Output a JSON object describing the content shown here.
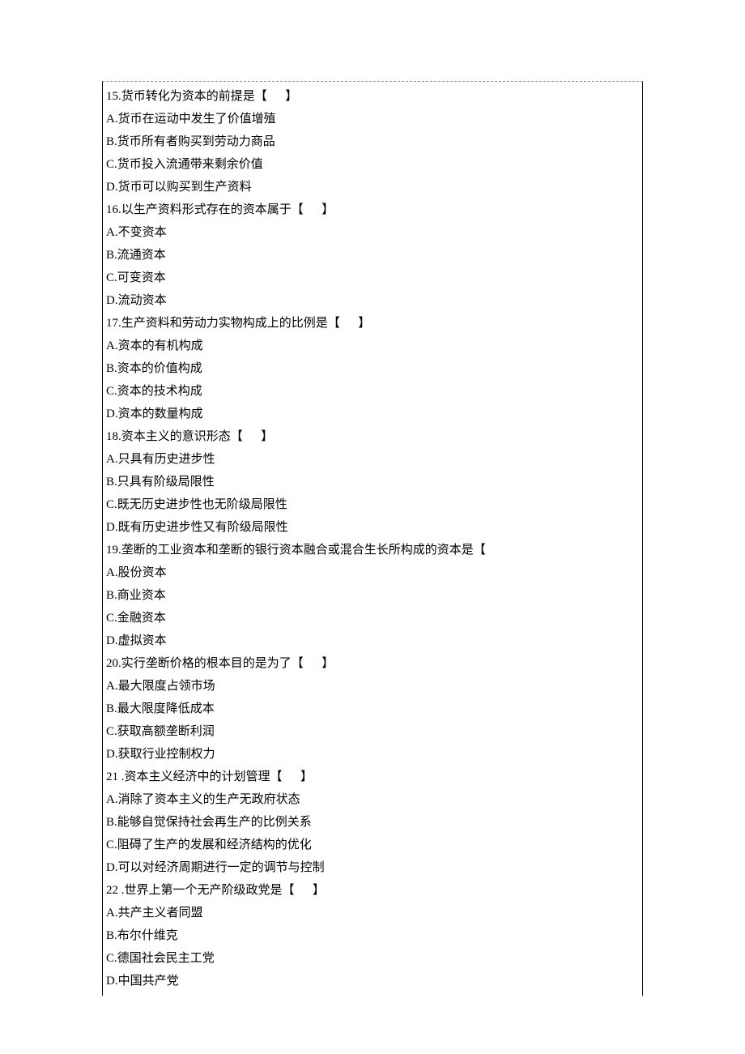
{
  "questions": [
    {
      "stem_prefix": "15.货币转化为资本的前提是【",
      "stem_suffix": "】",
      "options": [
        "A.货币在运动中发生了价值增殖",
        "B.货币所有者购买到劳动力商品",
        "C.货币投入流通带来剩余价值",
        "D.货币可以购买到生产资料"
      ]
    },
    {
      "stem_prefix": "16.以生产资料形式存在的资本属于【",
      "stem_suffix": "】",
      "options": [
        "A.不变资本",
        "B.流通资本",
        "C.可变资本",
        "D.流动资本"
      ]
    },
    {
      "stem_prefix": "17.生产资料和劳动力实物构成上的比例是【",
      "stem_suffix": "】",
      "options": [
        "A.资本的有机构成",
        "B.资本的价值构成",
        "C.资本的技术构成",
        "D.资本的数量构成"
      ]
    },
    {
      "stem_prefix": "18.资本主义的意识形态【",
      "stem_suffix": "】",
      "options": [
        "A.只具有历史进步性",
        "B.只具有阶级局限性",
        "C.既无历史进步性也无阶级局限性",
        "D.既有历史进步性又有阶级局限性"
      ]
    },
    {
      "stem_prefix": "19.垄断的工业资本和垄断的银行资本融合或混合生长所构成的资本是【",
      "stem_suffix": "",
      "options": [
        "A.股份资本",
        "B.商业资本",
        "C.金融资本",
        "D.虚拟资本"
      ]
    },
    {
      "stem_prefix": "20.实行垄断价格的根本目的是为了【",
      "stem_suffix": "】",
      "options": [
        "A.最大限度占领市场",
        "B.最大限度降低成本",
        "C.获取高额垄断利润",
        "D.获取行业控制权力"
      ]
    },
    {
      "stem_prefix": "21 .资本主义经济中的计划管理【",
      "stem_suffix": "】",
      "options": [
        "A.消除了资本主义的生产无政府状态",
        "B.能够自觉保持社会再生产的比例关系",
        "C.阻碍了生产的发展和经济结构的优化",
        "D.可以对经济周期进行一定的调节与控制"
      ]
    },
    {
      "stem_prefix": "22 .世界上第一个无产阶级政党是【",
      "stem_suffix": "】",
      "options": [
        "A.共产主义者同盟",
        "B.布尔什维克",
        "C.德国社会民主工党",
        "D.中国共产党"
      ]
    }
  ],
  "blank_spaces": "      "
}
